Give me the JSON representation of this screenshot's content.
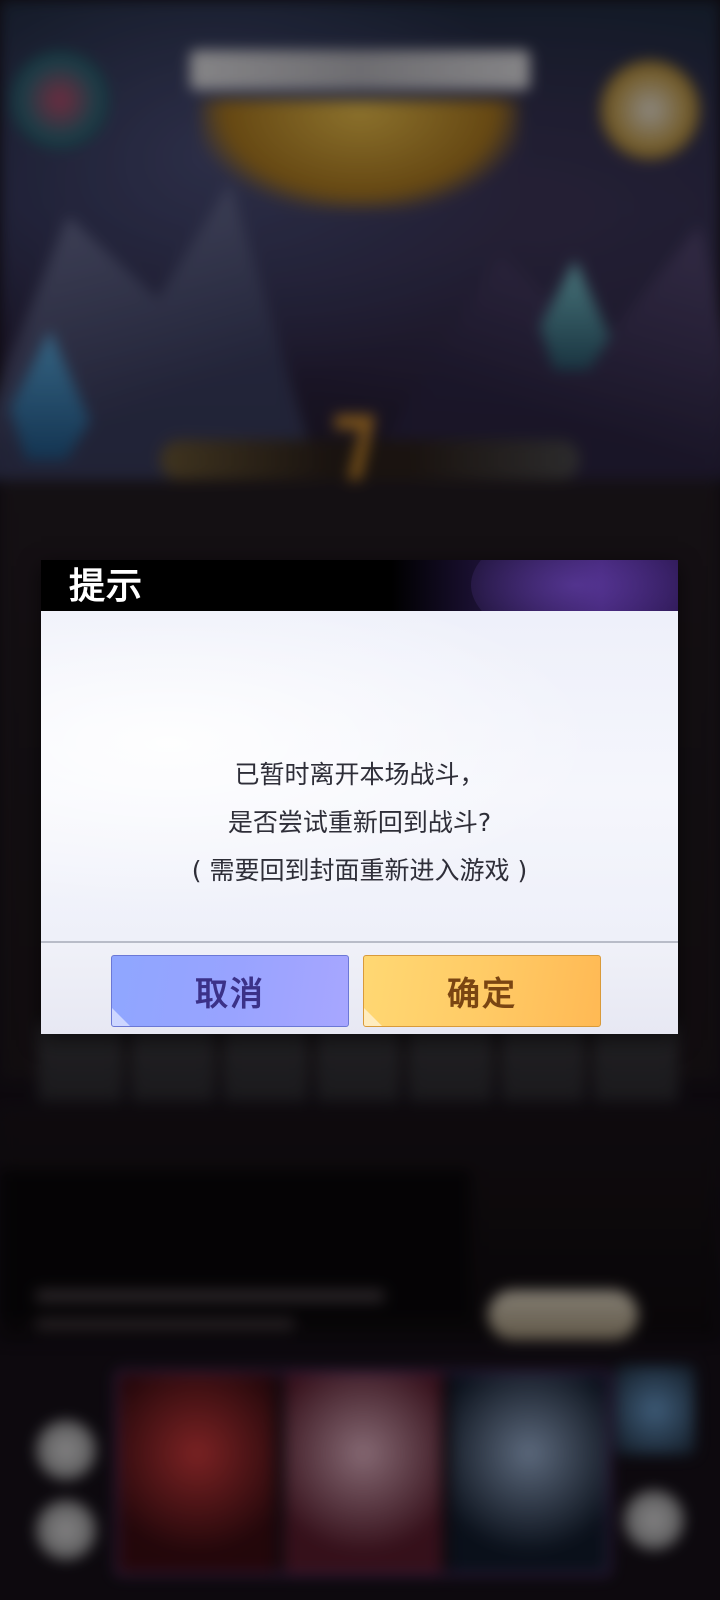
{
  "dialog": {
    "title": "提示",
    "message_lines": [
      "已暂时离开本场战斗，",
      "是否尝试重新回到战斗?",
      "( 需要回到封面重新进入游戏 )"
    ],
    "cancel_label": "取消",
    "confirm_label": "确定"
  },
  "colors": {
    "header_bg": "#000000",
    "cancel_button": "#98a3ff",
    "confirm_button": "#ffcb66",
    "cancel_text": "#3b3188",
    "confirm_text": "#7a4512"
  }
}
